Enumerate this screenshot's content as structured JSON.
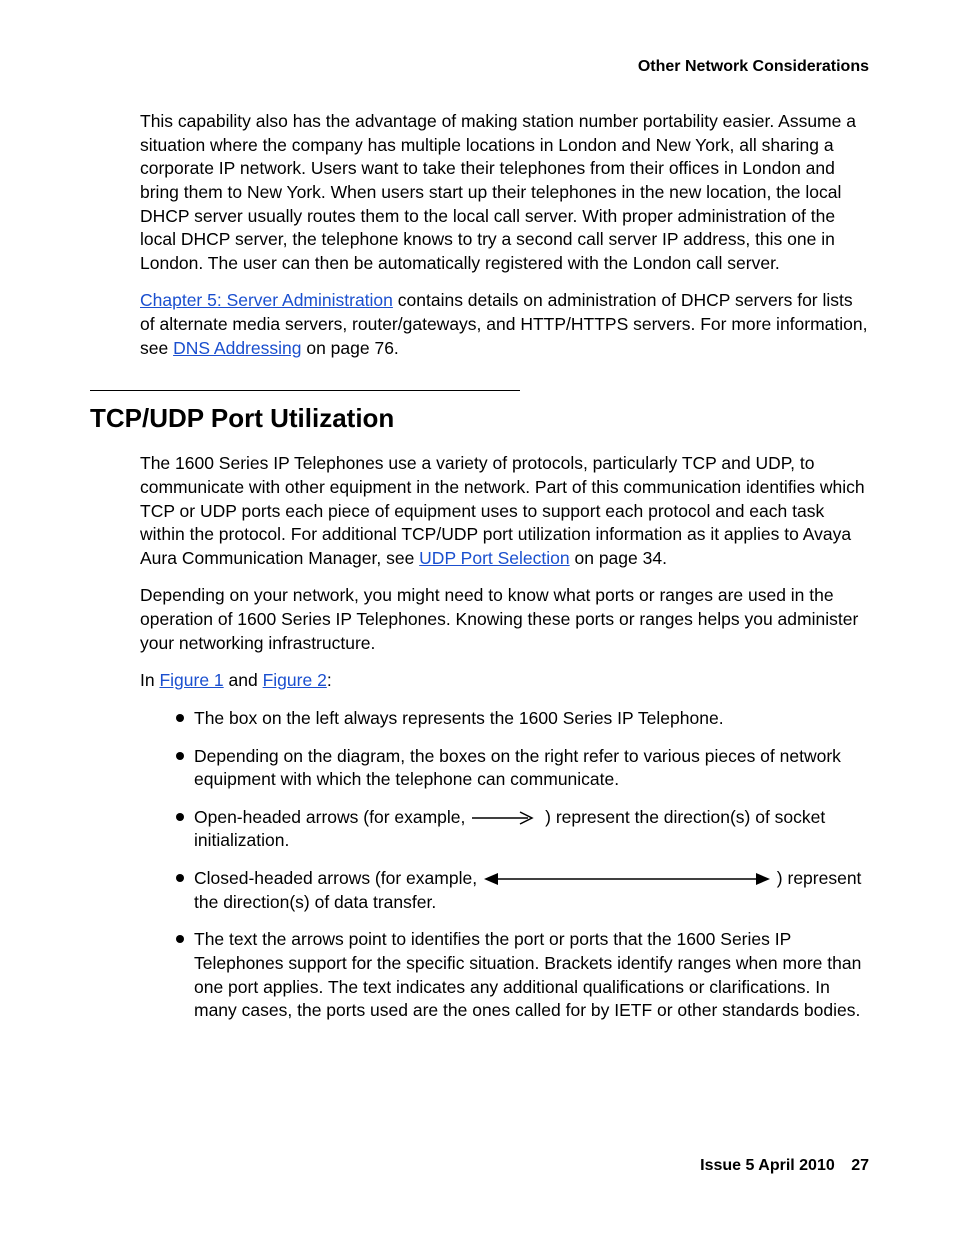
{
  "header": {
    "running_title": "Other Network Considerations"
  },
  "paragraphs": {
    "p1": "This capability also has the advantage of making station number portability easier. Assume a situation where the company has multiple locations in London and New York, all sharing a corporate IP network. Users want to take their telephones from their offices in London and bring them to New York. When users start up their telephones in the new location, the local DHCP server usually routes them to the local call server. With proper administration of the local DHCP server, the telephone knows to try a second call server IP address, this one in London. The user can then be automatically registered with the London call server.",
    "p2_link": "Chapter 5: Server Administration",
    "p2_mid": " contains details on administration of DHCP servers for lists of alternate media servers, router/gateways, and HTTP/HTTPS servers. For more information, see ",
    "p2_link2": "DNS Addressing",
    "p2_tail": " on page 76."
  },
  "section": {
    "title": "TCP/UDP Port Utilization",
    "p3_a": "The 1600 Series IP Telephones use a variety of protocols, particularly TCP and UDP, to communicate with other equipment in the network. Part of this communication identifies which TCP or UDP ports each piece of equipment uses to support each protocol and each task within the protocol. For additional TCP/UDP port utilization information as it applies to Avaya Aura Communication Manager, see ",
    "p3_link": "UDP Port Selection",
    "p3_b": " on page 34.",
    "p4": "Depending on your network, you might need to know what ports or ranges are used in the operation of 1600 Series IP Telephones. Knowing these ports or ranges helps you administer your networking infrastructure.",
    "p5_a": "In ",
    "p5_link1": "Figure 1",
    "p5_mid": " and ",
    "p5_link2": "Figure 2",
    "p5_b": ":"
  },
  "bullets": {
    "b1": "The box on the left always represents the 1600 Series IP Telephone.",
    "b2": "Depending on the diagram, the boxes on the right refer to various pieces of network equipment with which the telephone can communicate.",
    "b3_a": "Open-headed arrows (for example, ",
    "b3_b": " ) represent the direction(s) of socket initialization.",
    "b4_a": "Closed-headed arrows (for example, ",
    "b4_b": " ) represent the direction(s) of data transfer.",
    "b5": "The text the arrows point to identifies the port or ports that the 1600 Series IP Telephones support for the specific situation. Brackets identify ranges when more than one port applies. The text indicates any additional qualifications or clarifications. In many cases, the ports used are the ones called for by IETF or other standards bodies."
  },
  "footer": {
    "issue": "Issue 5   April 2010",
    "page": "27"
  }
}
